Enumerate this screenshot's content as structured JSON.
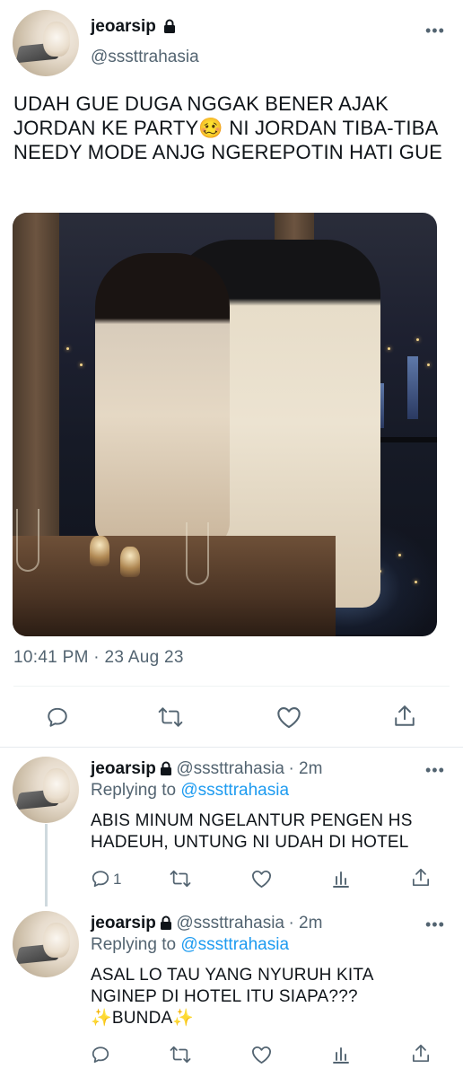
{
  "main_tweet": {
    "display_name": "jeoarsip",
    "handle": "@sssttrahasia",
    "text": "UDAH GUE DUGA NGGAK BENER AJAK JORDAN KE PARTY🥴 NI JORDAN TIBA-TIBA NEEDY MODE ANJG NGEREPOTIN HATI GUE",
    "timestamp": "10:41 PM · 23 Aug 23",
    "more": "•••",
    "actions": [
      "reply-icon",
      "retweet-icon",
      "like-icon",
      "share-icon"
    ]
  },
  "replies": [
    {
      "display_name": "jeoarsip",
      "handle": "@sssttrahasia",
      "time": "· 2m",
      "replying_prefix": "Replying to",
      "replying_to": "@sssttrahasia",
      "text": "ABIS MINUM NGELANTUR PENGEN HS HADEUH, UNTUNG NI UDAH DI HOTEL",
      "reply_count": "1",
      "more": "•••"
    },
    {
      "display_name": "jeoarsip",
      "handle": "@sssttrahasia",
      "time": "· 2m",
      "replying_prefix": "Replying to",
      "replying_to": "@sssttrahasia",
      "text": "ASAL LO TAU YANG NYURUH KITA NGINEP DI HOTEL ITU SIAPA??? ✨BUNDA✨",
      "reply_count": "",
      "more": "•••"
    }
  ],
  "colors": {
    "text": "#0f1419",
    "secondary": "#536471",
    "link": "#1d9bf0",
    "divider": "#eff3f4"
  }
}
